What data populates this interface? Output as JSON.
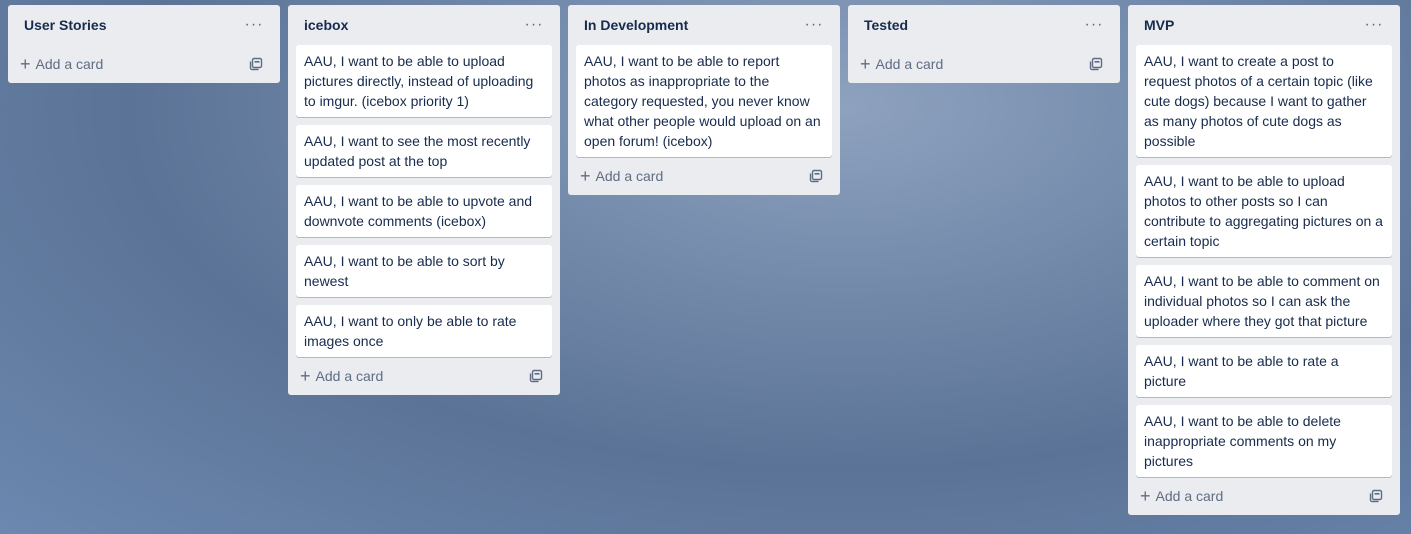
{
  "lists": [
    {
      "title": "User Stories",
      "cards": [],
      "add_label": "Add a card"
    },
    {
      "title": "icebox",
      "cards": [
        "AAU, I want to be able to upload pictures directly, instead of uploading to imgur. (icebox priority 1)",
        "AAU, I want to see the most recently updated post at the top",
        "AAU, I want to be able to upvote and downvote comments (icebox)",
        "AAU, I want to be able to sort by newest",
        "AAU, I want to only be able to rate images once"
      ],
      "add_label": "Add a card"
    },
    {
      "title": "In Development",
      "cards": [
        "AAU, I want to be able to report photos as inappropriate to the category requested, you never know what other people would upload on an open forum! (icebox)"
      ],
      "add_label": "Add a card"
    },
    {
      "title": "Tested",
      "cards": [],
      "add_label": "Add a card"
    },
    {
      "title": "MVP",
      "cards": [
        "AAU, I want to create a post to request photos of a certain topic (like cute dogs) because I want to gather as many photos of cute dogs as possible",
        "AAU, I want to be able to upload photos to other posts so I can contribute to aggregating pictures on a certain topic",
        "AAU, I want to be able to comment on individual photos so I can ask the uploader where they got that picture",
        "AAU, I want to be able to rate a picture",
        "AAU, I want to be able to delete inappropriate comments on my pictures"
      ],
      "add_label": "Add a card"
    }
  ],
  "icons": {
    "menu": "more-horizontal-icon",
    "add": "plus-icon",
    "template": "card-template-icon"
  },
  "colors": {
    "list_bg": "#ebecf0",
    "card_bg": "#ffffff",
    "text": "#172b4d",
    "muted": "#5e6c84"
  }
}
